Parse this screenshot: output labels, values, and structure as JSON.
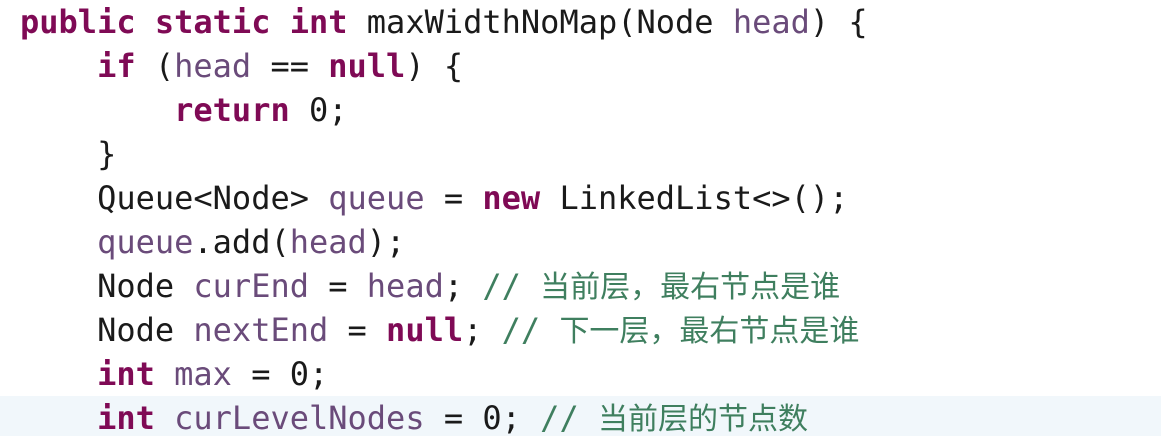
{
  "code": {
    "language": "java",
    "lines": [
      {
        "indent": "",
        "tokens": [
          {
            "t": "kw",
            "v": "public"
          },
          {
            "t": "pl",
            "v": " "
          },
          {
            "t": "kw",
            "v": "static"
          },
          {
            "t": "pl",
            "v": " "
          },
          {
            "t": "kw",
            "v": "int"
          },
          {
            "t": "pl",
            "v": " maxWidthNoMap(Node "
          },
          {
            "t": "id",
            "v": "head"
          },
          {
            "t": "pl",
            "v": ") {"
          }
        ]
      },
      {
        "indent": "    ",
        "tokens": [
          {
            "t": "kw",
            "v": "if"
          },
          {
            "t": "pl",
            "v": " ("
          },
          {
            "t": "id",
            "v": "head"
          },
          {
            "t": "pl",
            "v": " == "
          },
          {
            "t": "kw",
            "v": "null"
          },
          {
            "t": "pl",
            "v": ") {"
          }
        ]
      },
      {
        "indent": "        ",
        "tokens": [
          {
            "t": "kw",
            "v": "return"
          },
          {
            "t": "pl",
            "v": " 0;"
          }
        ]
      },
      {
        "indent": "    ",
        "tokens": [
          {
            "t": "pl",
            "v": "}"
          }
        ]
      },
      {
        "indent": "    ",
        "tokens": [
          {
            "t": "pl",
            "v": "Queue<Node> "
          },
          {
            "t": "id",
            "v": "queue"
          },
          {
            "t": "pl",
            "v": " = "
          },
          {
            "t": "kw",
            "v": "new"
          },
          {
            "t": "pl",
            "v": " LinkedList<>();"
          }
        ]
      },
      {
        "indent": "    ",
        "tokens": [
          {
            "t": "id",
            "v": "queue"
          },
          {
            "t": "pl",
            "v": ".add("
          },
          {
            "t": "id",
            "v": "head"
          },
          {
            "t": "pl",
            "v": ");"
          }
        ]
      },
      {
        "indent": "    ",
        "tokens": [
          {
            "t": "pl",
            "v": "Node "
          },
          {
            "t": "id",
            "v": "curEnd"
          },
          {
            "t": "pl",
            "v": " = "
          },
          {
            "t": "id",
            "v": "head"
          },
          {
            "t": "pl",
            "v": "; "
          },
          {
            "t": "cm",
            "v": "// "
          },
          {
            "t": "cmcn",
            "v": "当前层，最右节点是谁"
          }
        ]
      },
      {
        "indent": "    ",
        "tokens": [
          {
            "t": "pl",
            "v": "Node "
          },
          {
            "t": "id",
            "v": "nextEnd"
          },
          {
            "t": "pl",
            "v": " = "
          },
          {
            "t": "kw",
            "v": "null"
          },
          {
            "t": "pl",
            "v": "; "
          },
          {
            "t": "cm",
            "v": "// "
          },
          {
            "t": "cmcn",
            "v": "下一层，最右节点是谁"
          }
        ]
      },
      {
        "indent": "    ",
        "tokens": [
          {
            "t": "kw",
            "v": "int"
          },
          {
            "t": "pl",
            "v": " "
          },
          {
            "t": "id",
            "v": "max"
          },
          {
            "t": "pl",
            "v": " = 0;"
          }
        ]
      },
      {
        "indent": "    ",
        "tokens": [
          {
            "t": "kw",
            "v": "int"
          },
          {
            "t": "pl",
            "v": " "
          },
          {
            "t": "id",
            "v": "curLevelNodes"
          },
          {
            "t": "pl",
            "v": " = 0; "
          },
          {
            "t": "cm",
            "v": "// "
          },
          {
            "t": "cmcn",
            "v": "当前层的节点数"
          }
        ]
      }
    ]
  },
  "colors": {
    "keyword": "#7f0a55",
    "identifier": "#6a4b7a",
    "comment": "#3f7f5f",
    "plain": "#1a1a1a",
    "current_line_highlight": "#f1f7fb"
  }
}
